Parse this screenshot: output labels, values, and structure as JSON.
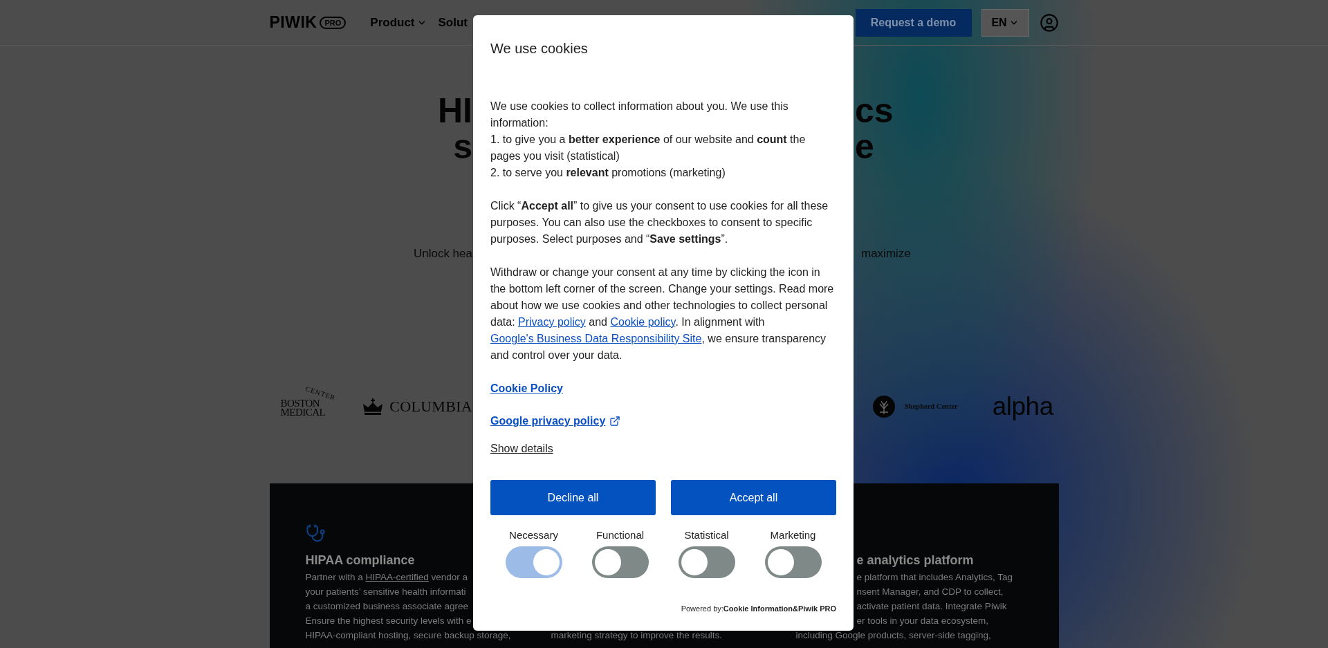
{
  "header": {
    "logo": {
      "wordmark": "PIWIK",
      "badge": "PRO"
    },
    "nav": [
      {
        "label": "Product",
        "has_menu": true
      },
      {
        "label": "Solut",
        "has_menu": false
      }
    ],
    "demo_button": "Request a demo",
    "language": "EN"
  },
  "hero": {
    "title": [
      {
        "left": "HI",
        "right": "cs"
      },
      {
        "left": "s",
        "right": "e"
      }
    ],
    "subtitle": {
      "left": "Unlock hea",
      "right": "maximize"
    }
  },
  "logos": [
    {
      "kind": "boston",
      "lines": [
        "BOSTON",
        "MEDICAL"
      ],
      "arc": "CENTER"
    },
    {
      "kind": "columbia",
      "text": "COLUMBIA"
    },
    {
      "kind": "shepherd",
      "text": "Shepherd Center"
    },
    {
      "kind": "alpha",
      "text": "alpha"
    }
  ],
  "features": [
    {
      "icon": true,
      "title": "HIPAA compliance",
      "text": [
        {
          "kind": "text",
          "text": "Partner with a "
        },
        {
          "kind": "link",
          "text": "HIPAA-certified"
        },
        {
          "kind": "text",
          "text": " vendor a\nyour patients’ sensitive health informati\na customized business associate agree\nEnsure the highest security levels with e"
        }
      ],
      "bottom_line": "HIPAA-compliant hosting, secure backup storage,"
    },
    {
      "bottom_line": "marketing strategy to improve the results."
    },
    {
      "title": "e analytics platform",
      "text": [
        {
          "kind": "text",
          "text": "e platform that includes Analytics, Tag\nnsent Manager, and CDP to collect,\nactivate patient data. Integrate Piwik\ner tools in your data ecosystem,"
        }
      ],
      "bottom_line": "including Google products, server-side tagging,"
    }
  ],
  "cookie_dialog": {
    "title": "We use cookies",
    "paragraphs": [
      [
        {
          "kind": "text",
          "text": "We use cookies to collect information about you. We use this information:\n1. to give you a **better experience** of our website and **count** the pages you visit (statistical)\n2. to serve you **relevant** promotions (marketing)"
        }
      ],
      [
        {
          "kind": "text",
          "text": "Click “**Accept all**” to give us your consent to use cookies for all these purposes. You can also use the checkboxes to consent to specific purposes. Select purposes and “**Save settings**”."
        }
      ],
      [
        {
          "kind": "text",
          "text": "Withdraw or change your consent at any time by clicking the icon in the bottom left corner of the screen. Change your settings. Read more about how we use cookies and other technologies to collect personal data: "
        },
        {
          "kind": "link",
          "text": "Privacy policy"
        },
        {
          "kind": "text",
          "text": " and "
        },
        {
          "kind": "link",
          "text": "Cookie policy"
        },
        {
          "kind": "text",
          "text": ". In alignment with "
        },
        {
          "kind": "link",
          "text": "Google's Business Data Responsibility Site"
        },
        {
          "kind": "text",
          "text": ", we ensure transparency and control over your data."
        }
      ]
    ],
    "links": [
      {
        "label": "Cookie Policy",
        "external": false
      },
      {
        "label": "Google privacy policy",
        "external": true
      }
    ],
    "details_link": "Show details",
    "buttons": [
      "Decline all",
      "Accept all"
    ],
    "toggles": [
      {
        "label": "Necessary",
        "checked": true,
        "disabled": true
      },
      {
        "label": "Functional",
        "checked": false,
        "disabled": false
      },
      {
        "label": "Statistical",
        "checked": false,
        "disabled": false
      },
      {
        "label": "Marketing",
        "checked": false,
        "disabled": false
      }
    ],
    "powered_by": "Powered by:**Cookie Information&Piwik PRO**"
  }
}
